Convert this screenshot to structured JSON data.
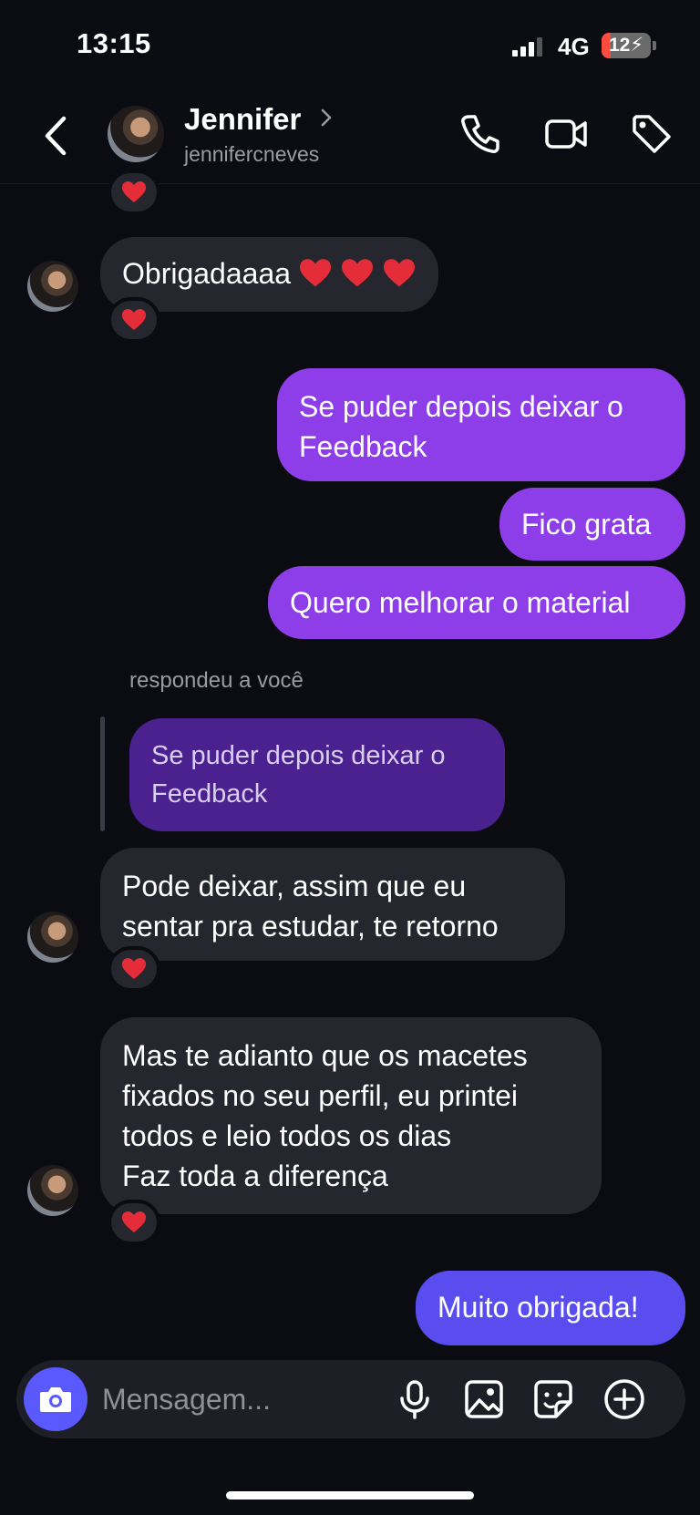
{
  "status_bar": {
    "time": "13:15",
    "network": "4G",
    "battery": "12"
  },
  "header": {
    "name": "Jennifer",
    "username": "jennifercneves"
  },
  "messages": [
    {
      "id": "m1",
      "text": "Obrigadaaaa"
    },
    {
      "id": "m2",
      "text": "Se puder depois deixar o Feedback"
    },
    {
      "id": "m3",
      "text": "Fico grata"
    },
    {
      "id": "m4",
      "text": "Quero melhorar o material"
    },
    {
      "id": "m5",
      "reply_label": "respondeu a você",
      "quoted": "Se puder depois deixar o Feedback",
      "text": "Pode deixar, assim que eu sentar pra estudar, te retorno"
    },
    {
      "id": "m6",
      "text": "Mas te adianto que os macetes fixados no seu perfil, eu printei todos e leio todos os dias\nFaz toda a diferença"
    },
    {
      "id": "m7",
      "text": "Muito obrigada!"
    }
  ],
  "composer": {
    "placeholder": "Mensagem..."
  },
  "colors": {
    "background": "#0b0c12",
    "received": "#25262e",
    "sent": "#8e3ee8",
    "sent_last": "#5a4df0",
    "camera": "#5a58ff",
    "heart": "#e52d3a"
  },
  "icons": [
    "back-icon",
    "chevron-right-icon",
    "phone-icon",
    "video-icon",
    "tag-icon",
    "heart-icon",
    "camera-icon",
    "microphone-icon",
    "image-icon",
    "sticker-icon",
    "plus-icon"
  ]
}
